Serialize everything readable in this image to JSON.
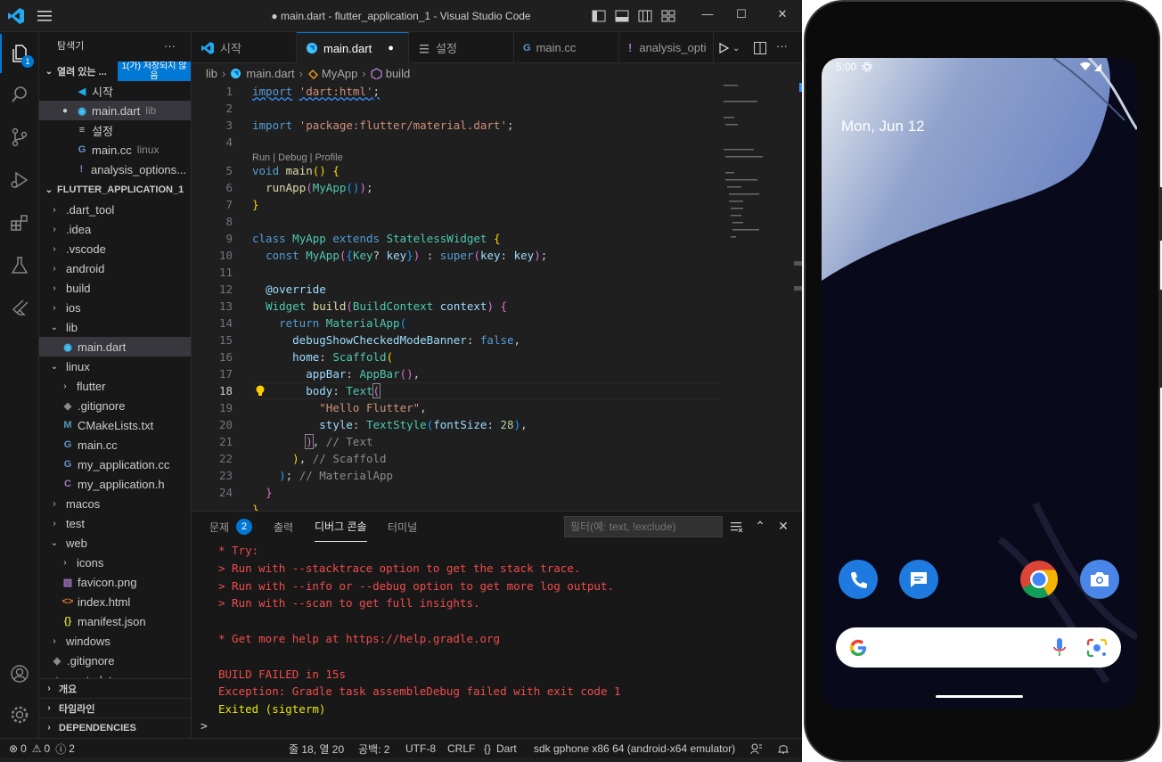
{
  "titlebar": {
    "title": "● main.dart - flutter_application_1 - Visual Studio Code",
    "min": "—",
    "max": "☐",
    "close": "✕"
  },
  "activity": {
    "explorer_badge": "1"
  },
  "sidebar": {
    "title": "탐색기",
    "more": "···",
    "open_editors_header": "열려 있는 ...",
    "unsaved_badge": "1(가) 저장되지 않음",
    "open_editors": [
      {
        "icon": "flutter-icon",
        "name": "시작",
        "desc": ""
      },
      {
        "icon": "dart-icon",
        "name": "main.dart",
        "desc": "lib"
      },
      {
        "icon": "settings-file-icon",
        "name": "설정",
        "desc": ""
      },
      {
        "icon": "cpp-icon",
        "name": "main.cc",
        "desc": "linux"
      },
      {
        "icon": "yaml-icon",
        "name": "analysis_options...",
        "desc": ""
      }
    ],
    "project_header": "FLUTTER_APPLICATION_1",
    "tree": [
      {
        "label": ".dart_tool",
        "type": "folder"
      },
      {
        "label": ".idea",
        "type": "folder"
      },
      {
        "label": ".vscode",
        "type": "folder"
      },
      {
        "label": "android",
        "type": "folder"
      },
      {
        "label": "build",
        "type": "folder"
      },
      {
        "label": "ios",
        "type": "folder"
      },
      {
        "label": "lib",
        "type": "folder-open"
      },
      {
        "label": "main.dart",
        "type": "file"
      },
      {
        "label": "linux",
        "type": "folder-open"
      },
      {
        "label": "flutter",
        "type": "folder"
      },
      {
        "label": ".gitignore",
        "type": "file"
      },
      {
        "label": "CMakeLists.txt",
        "type": "file"
      },
      {
        "label": "main.cc",
        "type": "file"
      },
      {
        "label": "my_application.cc",
        "type": "file"
      },
      {
        "label": "my_application.h",
        "type": "file"
      },
      {
        "label": "macos",
        "type": "folder"
      },
      {
        "label": "test",
        "type": "folder"
      },
      {
        "label": "web",
        "type": "folder-open"
      },
      {
        "label": "icons",
        "type": "folder"
      },
      {
        "label": "favicon.png",
        "type": "file"
      },
      {
        "label": "index.html",
        "type": "file"
      },
      {
        "label": "manifest.json",
        "type": "file"
      },
      {
        "label": "windows",
        "type": "folder"
      },
      {
        "label": ".gitignore",
        "type": "file"
      },
      {
        "label": ".metadata",
        "type": "file"
      }
    ],
    "bottom_sections": [
      "개요",
      "타임라인",
      "DEPENDENCIES"
    ]
  },
  "tabs": [
    {
      "label": "시작",
      "icon": "flutter-icon"
    },
    {
      "label": "main.dart",
      "icon": "dart-icon",
      "modified": "●"
    },
    {
      "label": "설정",
      "icon": "settings-file-icon"
    },
    {
      "label": "main.cc",
      "icon": "cpp-icon"
    },
    {
      "label": "analysis_opti",
      "icon": "yaml-icon"
    }
  ],
  "breadcrumb": [
    "lib",
    "main.dart",
    "MyApp",
    "build"
  ],
  "codelens": "Run | Debug | Profile",
  "line_numbers": [
    "1",
    "2",
    "3",
    "4",
    "5",
    "6",
    "7",
    "8",
    "9",
    "10",
    "11",
    "12",
    "13",
    "14",
    "15",
    "16",
    "17",
    "18",
    "19",
    "20",
    "21",
    "22",
    "23",
    "24"
  ],
  "panel": {
    "tabs": [
      "문제",
      "출력",
      "디버그 콘솔",
      "터미널"
    ],
    "problems_count": "2",
    "filter_placeholder": "필터(예: text, !exclude)",
    "output": [
      "* Try:",
      "> Run with --stacktrace option to get the stack trace.",
      "> Run with --info or --debug option to get more log output.",
      "> Run with --scan to get full insights.",
      "",
      "* Get more help at https://help.gradle.org",
      "",
      "BUILD FAILED in 15s",
      "Exception: Gradle task assembleDebug failed with exit code 1",
      "Exited (sigterm)"
    ],
    "prompt": ">"
  },
  "statusbar": {
    "errors": "0",
    "warnings": "0",
    "infos": "2",
    "position": "줄 18, 열 20",
    "spaces": "공백: 2",
    "encoding": "UTF-8",
    "eol": "CRLF",
    "language": "Dart",
    "device": "sdk gphone x86 64 (android-x64 emulator)"
  },
  "phone": {
    "time": "5:00",
    "date": "Mon, Jun 12",
    "dock_icons": [
      "phone-icon",
      "messages-icon",
      "chrome-icon",
      "camera-icon"
    ]
  },
  "colors": {
    "accent": "#0078d4",
    "editor_bg": "#1f1f1f",
    "error_text": "#f14c4c"
  }
}
